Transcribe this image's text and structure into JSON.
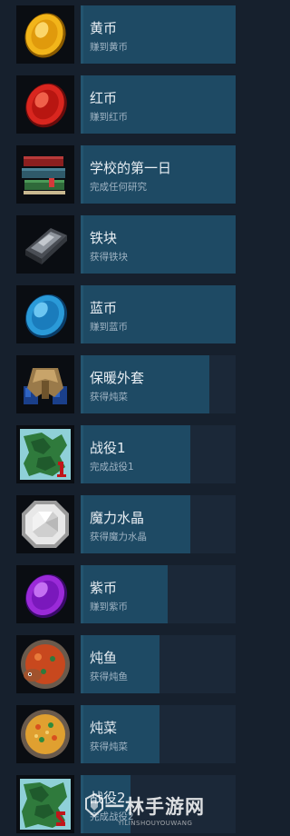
{
  "achievements": [
    {
      "title": "黄币",
      "desc": "赚到黄币",
      "icon": "gold-coin-icon",
      "progress": 1.0
    },
    {
      "title": "红币",
      "desc": "赚到红币",
      "icon": "red-coin-icon",
      "progress": 1.0
    },
    {
      "title": "学校的第一日",
      "desc": "完成任何研究",
      "icon": "books-icon",
      "progress": 1.0
    },
    {
      "title": "铁块",
      "desc": "获得铁块",
      "icon": "iron-ingot-icon",
      "progress": 1.0
    },
    {
      "title": "蓝币",
      "desc": "赚到蓝币",
      "icon": "blue-coin-icon",
      "progress": 1.0
    },
    {
      "title": "保暖外套",
      "desc": "获得炖菜",
      "icon": "warm-coat-icon",
      "progress": 0.83
    },
    {
      "title": "战役1",
      "desc": "完成战役1",
      "icon": "campaign-map-1-icon",
      "progress": 0.71
    },
    {
      "title": "魔力水晶",
      "desc": "获得魔力水晶",
      "icon": "mana-crystal-icon",
      "progress": 0.71
    },
    {
      "title": "紫币",
      "desc": "赚到紫币",
      "icon": "purple-coin-icon",
      "progress": 0.56
    },
    {
      "title": "炖鱼",
      "desc": "获得炖鱼",
      "icon": "fish-stew-icon",
      "progress": 0.51
    },
    {
      "title": "炖菜",
      "desc": "获得炖菜",
      "icon": "veg-stew-icon",
      "progress": 0.51
    },
    {
      "title": "战役2",
      "desc": "完成战役2",
      "icon": "campaign-map-2-icon",
      "progress": 0.32
    }
  ],
  "watermark": {
    "text": "一林手游网",
    "sub": "YILINSHOUYOUWANG"
  },
  "colors": {
    "background": "#16202d",
    "bar_track": "#1b2838",
    "bar_fill": "#1e4a64"
  }
}
